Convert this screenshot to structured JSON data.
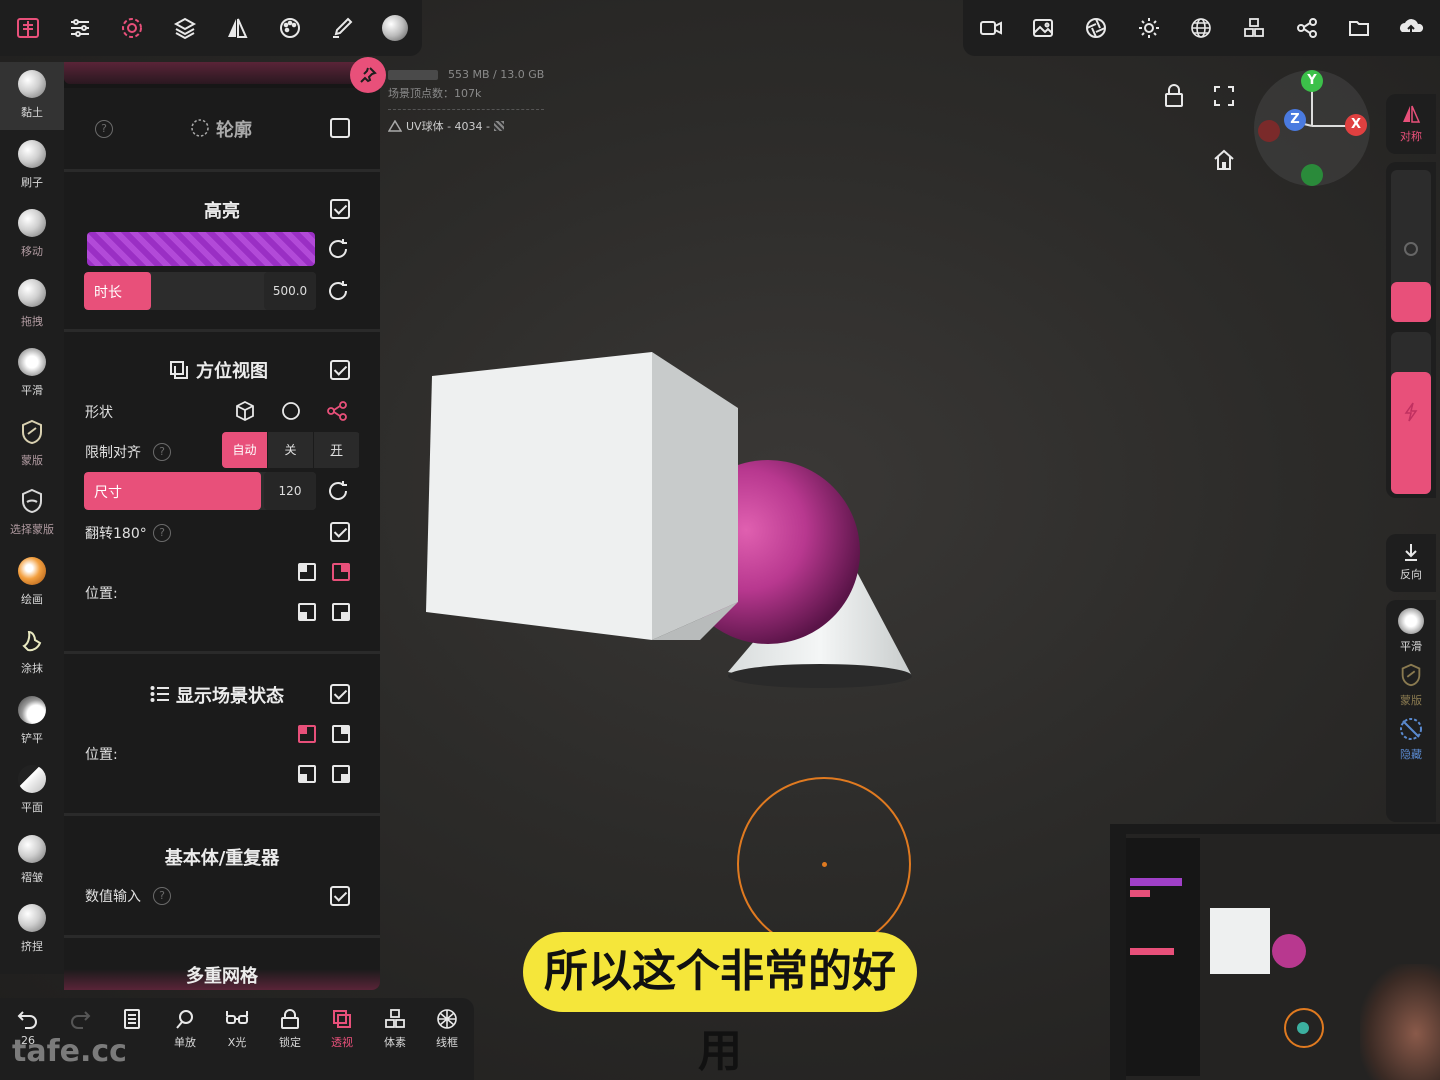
{
  "topbar_left": {
    "icons": [
      "app-logo-icon",
      "sliders-icon",
      "settings-gear-icon",
      "layers-icon",
      "symmetry-icon",
      "palette-icon",
      "brush-stroke-icon",
      "material-sphere-icon"
    ]
  },
  "topbar_right": {
    "icons": [
      "camera-icon",
      "image-icon",
      "aperture-icon",
      "sun-icon",
      "grid-sphere-icon",
      "cubes-icon",
      "share-nodes-icon",
      "folder-icon",
      "cloud-upload-icon"
    ]
  },
  "tools": [
    {
      "label": "黏土",
      "active": true
    },
    {
      "label": "刷子"
    },
    {
      "label": "移动"
    },
    {
      "label": "拖拽"
    },
    {
      "label": "平滑"
    },
    {
      "label": "蒙版"
    },
    {
      "label": "选择蒙版"
    },
    {
      "label": "绘画"
    },
    {
      "label": "涂抹"
    },
    {
      "label": "铲平"
    },
    {
      "label": "平面"
    },
    {
      "label": "褶皱"
    },
    {
      "label": "挤捏"
    }
  ],
  "stats": {
    "memory": "553 MB / 13.0 GB",
    "vertices": "场景顶点数：107k",
    "object": "UV球体 - 4034 -"
  },
  "panel": {
    "contour": {
      "title": "轮廓",
      "checked": false
    },
    "highlight": {
      "title": "高亮",
      "checked": true,
      "duration_label": "时长",
      "duration_value": "500.0"
    },
    "orientation": {
      "title": "方位视图",
      "checked": true,
      "shape_label": "形状",
      "limit_label": "限制对齐",
      "limit_options": [
        "自动",
        "关",
        "开"
      ],
      "size_label": "尺寸",
      "size_value": "120",
      "flip_label": "翻转180°",
      "flip_checked": true,
      "position_label": "位置:"
    },
    "scene_state": {
      "title": "显示场景状态",
      "checked": true,
      "position_label": "位置:"
    },
    "primitive": {
      "title": "基本体/重复器",
      "numeric_label": "数值输入",
      "numeric_checked": true
    },
    "multires": {
      "title": "多重网格"
    }
  },
  "right_tools": {
    "symmetry": "对称",
    "reverse": "反向",
    "smooth": "平滑",
    "mask": "蒙版",
    "hide": "隐藏"
  },
  "gizmo": {
    "y": "Y",
    "z": "Z",
    "x": "X"
  },
  "bottombar": [
    {
      "label": "26",
      "icon": "undo-icon"
    },
    {
      "label": "",
      "icon": "redo-icon"
    },
    {
      "label": "",
      "icon": "notebook-icon"
    },
    {
      "label": "单放",
      "icon": "search-icon"
    },
    {
      "label": "X光",
      "icon": "glasses-icon"
    },
    {
      "label": "锁定",
      "icon": "lock-icon"
    },
    {
      "label": "透视",
      "icon": "perspective-icon"
    },
    {
      "label": "体素",
      "icon": "voxel-icon"
    },
    {
      "label": "线框",
      "icon": "wireframe-icon"
    }
  ],
  "caption": "所以这个非常的好用",
  "watermark": "tafe.cc",
  "colors": {
    "accent": "#e8507a",
    "sphere": "#b8388f",
    "caption_bg": "#f5e63a",
    "brush_ring": "#e07a20"
  }
}
